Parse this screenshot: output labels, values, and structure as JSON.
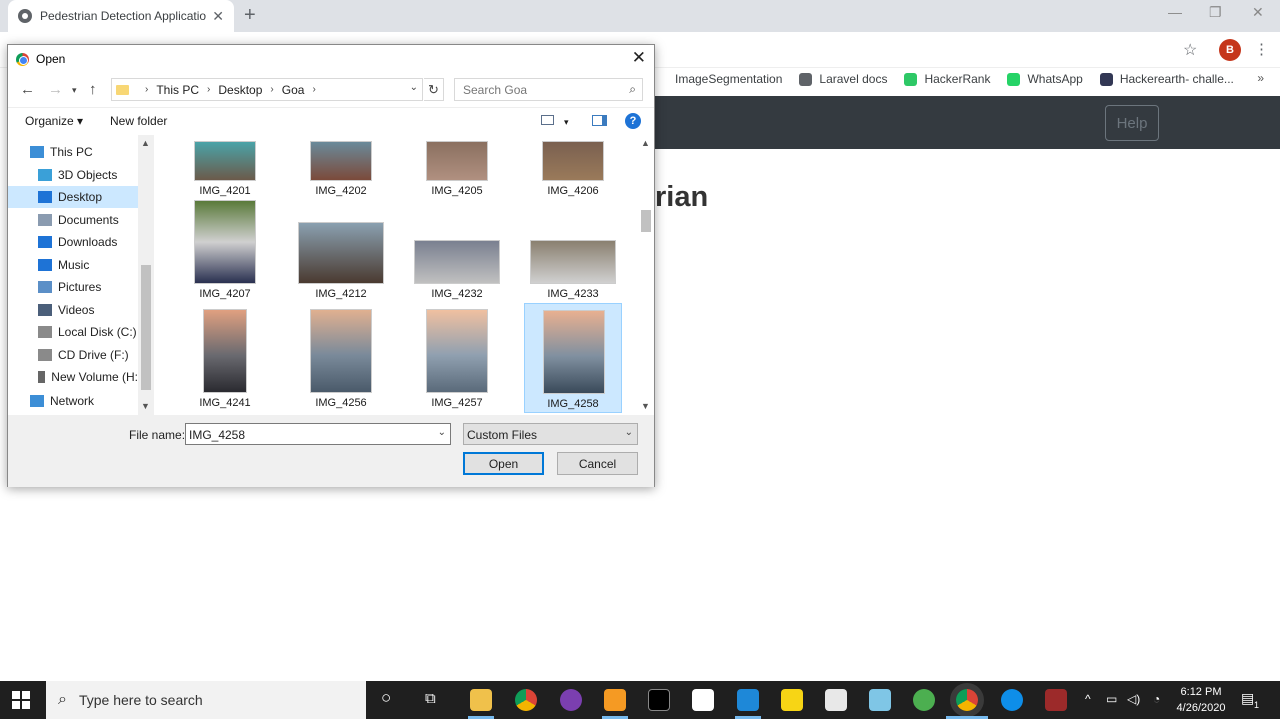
{
  "browser": {
    "tab_title": "Pedestrian Detection Application",
    "tab_close": "✕",
    "new_tab": "+",
    "window_controls": {
      "minimize": "—",
      "restore": "❐",
      "close": "✕"
    },
    "profile_initial": "B",
    "bookmarks": [
      {
        "label": "ImageSegmentation",
        "color": "#ffffff"
      },
      {
        "label": "Laravel docs",
        "color": "#5f6368"
      },
      {
        "label": "HackerRank",
        "color": "#2ec866"
      },
      {
        "label": "WhatsApp",
        "color": "#25d366"
      },
      {
        "label": "Hackerearth- challe...",
        "color": "#323754"
      }
    ],
    "bookmarks_more": "»"
  },
  "site": {
    "help_label": "Help",
    "heading_visible": "rian"
  },
  "dialog": {
    "title": "Open",
    "close": "✕",
    "breadcrumb": [
      "This PC",
      "Desktop",
      "Goa"
    ],
    "search_placeholder": "Search Goa",
    "organize_label": "Organize ▾",
    "new_folder_label": "New folder",
    "help_icon": "?",
    "nav_items": [
      {
        "label": "This PC",
        "selected": false,
        "indent": 0
      },
      {
        "label": "3D Objects",
        "selected": false,
        "indent": 1
      },
      {
        "label": "Desktop",
        "selected": true,
        "indent": 1
      },
      {
        "label": "Documents",
        "selected": false,
        "indent": 1
      },
      {
        "label": "Downloads",
        "selected": false,
        "indent": 1
      },
      {
        "label": "Music",
        "selected": false,
        "indent": 1
      },
      {
        "label": "Pictures",
        "selected": false,
        "indent": 1
      },
      {
        "label": "Videos",
        "selected": false,
        "indent": 1
      },
      {
        "label": "Local Disk (C:)",
        "selected": false,
        "indent": 1
      },
      {
        "label": "CD Drive (F:)",
        "selected": false,
        "indent": 1
      },
      {
        "label": "New Volume (H:",
        "selected": false,
        "indent": 1
      },
      {
        "label": "Network",
        "selected": false,
        "indent": 0
      }
    ],
    "files": [
      {
        "name": "IMG_4201",
        "selected": false
      },
      {
        "name": "IMG_4202",
        "selected": false
      },
      {
        "name": "IMG_4205",
        "selected": false
      },
      {
        "name": "IMG_4206",
        "selected": false
      },
      {
        "name": "IMG_4207",
        "selected": false
      },
      {
        "name": "IMG_4212",
        "selected": false
      },
      {
        "name": "IMG_4232",
        "selected": false
      },
      {
        "name": "IMG_4233",
        "selected": false
      },
      {
        "name": "IMG_4241",
        "selected": false
      },
      {
        "name": "IMG_4256",
        "selected": false
      },
      {
        "name": "IMG_4257",
        "selected": false
      },
      {
        "name": "IMG_4258",
        "selected": true
      }
    ],
    "file_name_label": "File name:",
    "file_name_value": "IMG_4258",
    "file_type_value": "Custom Files",
    "open_label": "Open",
    "cancel_label": "Cancel"
  },
  "taskbar": {
    "search_placeholder": "Type here to search",
    "time": "6:12 PM",
    "date": "4/26/2020",
    "notification_count": "1"
  }
}
